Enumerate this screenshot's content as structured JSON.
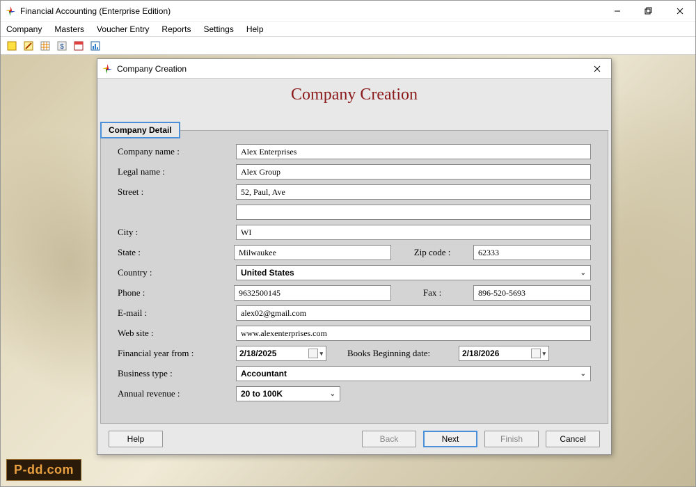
{
  "app": {
    "title": "Financial Accounting (Enterprise Edition)"
  },
  "menu": {
    "items": [
      "Company",
      "Masters",
      "Voucher Entry",
      "Reports",
      "Settings",
      "Help"
    ]
  },
  "dialog": {
    "title": "Company Creation",
    "heading": "Company Creation",
    "tab": "Company Detail",
    "labels": {
      "company_name": "Company name :",
      "legal_name": "Legal name :",
      "street": "Street :",
      "city": "City :",
      "state": "State :",
      "zip": "Zip code :",
      "country": "Country :",
      "phone": "Phone :",
      "fax": "Fax :",
      "email": "E-mail :",
      "website": "Web site :",
      "fin_year": "Financial year from :",
      "books_date": "Books Beginning date:",
      "business_type": "Business type :",
      "annual_revenue": "Annual revenue :"
    },
    "values": {
      "company_name": "Alex Enterprises",
      "legal_name": "Alex Group",
      "street1": "52, Paul, Ave",
      "street2": "",
      "city": "WI",
      "state": "Milwaukee",
      "zip": "62333",
      "country": "United States",
      "phone": "9632500145",
      "fax": "896-520-5693",
      "email": "alex02@gmail.com",
      "website": "www.alexenterprises.com",
      "fin_year": "2/18/2025",
      "books_date": "2/18/2026",
      "business_type": "Accountant",
      "annual_revenue": "20 to 100K"
    },
    "buttons": {
      "help": "Help",
      "back": "Back",
      "next": "Next",
      "finish": "Finish",
      "cancel": "Cancel"
    }
  },
  "watermark": "P-dd.com"
}
